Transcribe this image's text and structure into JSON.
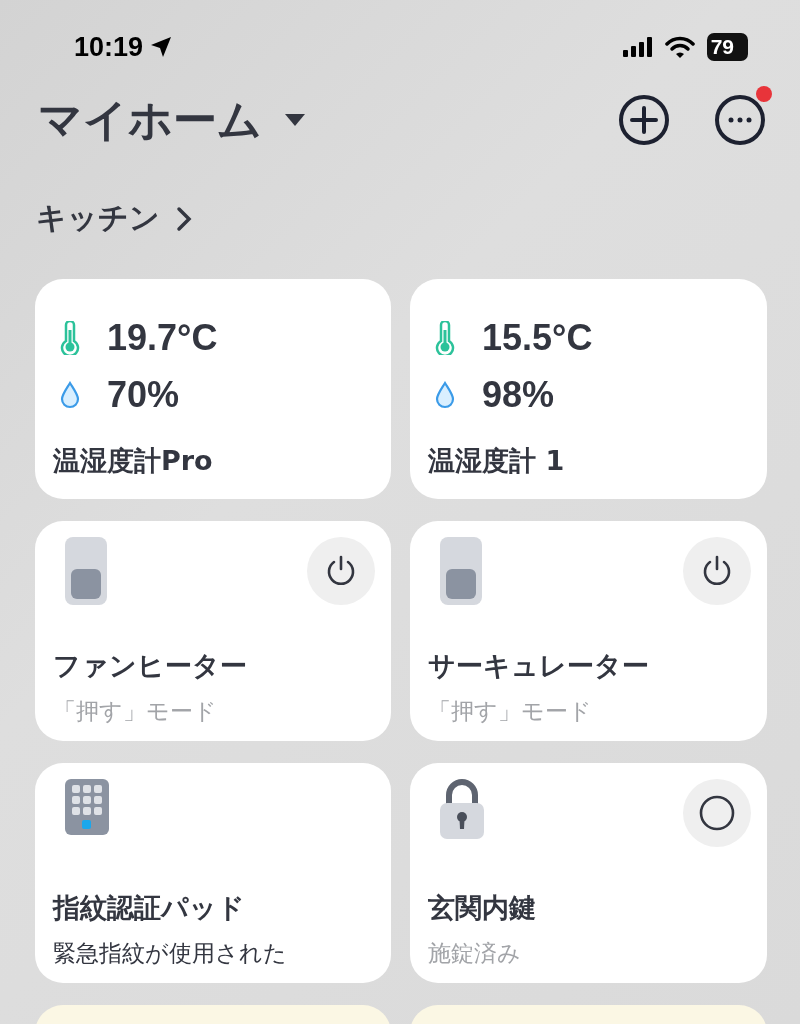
{
  "status_bar": {
    "time": "10:19",
    "battery": "79"
  },
  "header": {
    "title": "マイホーム",
    "notification": true
  },
  "section": {
    "title": "キッチン"
  },
  "cards": [
    {
      "kind": "sensor",
      "temperature": "19.7°C",
      "humidity": "70%",
      "name": "温湿度計Pro"
    },
    {
      "kind": "sensor",
      "temperature": "15.5°C",
      "humidity": "98%",
      "name": "温湿度計 1"
    },
    {
      "kind": "switch",
      "name": "ファンヒーター",
      "status": "「押す」モード",
      "alert": false
    },
    {
      "kind": "switch",
      "name": "サーキュレーター",
      "status": "「押す」モード",
      "alert": false
    },
    {
      "kind": "keypad",
      "name": "指紋認証パッド",
      "status": "緊急指紋が使用された",
      "alert": true
    },
    {
      "kind": "lock",
      "name": "玄関内鍵",
      "status": "施錠済み",
      "alert": false
    },
    {
      "kind": "cut"
    },
    {
      "kind": "cut"
    }
  ]
}
